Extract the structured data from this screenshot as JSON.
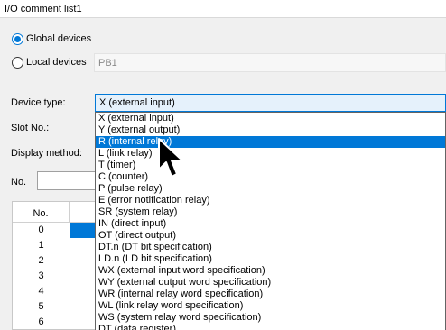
{
  "window": {
    "title": "I/O comment list1"
  },
  "scope": {
    "global_label": "Global devices",
    "global_selected": true,
    "local_label": "Local devices",
    "local_selected": false,
    "local_value": "PB1"
  },
  "device_type": {
    "label": "Device type:",
    "selected": "X (external input)",
    "options": [
      "X (external input)",
      "Y (external output)",
      "R (internal relay)",
      "L (link relay)",
      "T (timer)",
      "C (counter)",
      "P (pulse relay)",
      "E (error notification relay)",
      "SR (system relay)",
      "IN (direct input)",
      "OT (direct output)",
      "DT.n (DT bit specification)",
      "LD.n (LD bit specification)",
      "WX (external input word specification)",
      "WY (external output word specification)",
      "WR (internal relay word specification)",
      "WL (link relay word specification)",
      "WS (system relay word specification)",
      "DT (data register)"
    ],
    "highlighted_index": 2
  },
  "slot": {
    "label": "Slot No.:"
  },
  "display_method": {
    "label": "Display method:"
  },
  "number_filter": {
    "label": "No.",
    "value": ""
  },
  "grid": {
    "header": "No.",
    "rows": [
      "0",
      "1",
      "2",
      "3",
      "4",
      "5",
      "6"
    ],
    "selected_row": 0
  },
  "colors": {
    "accent": "#0078d7",
    "combo_bg": "#e5f1fb"
  },
  "cursor": {
    "icon": "arrow-cursor-icon"
  }
}
